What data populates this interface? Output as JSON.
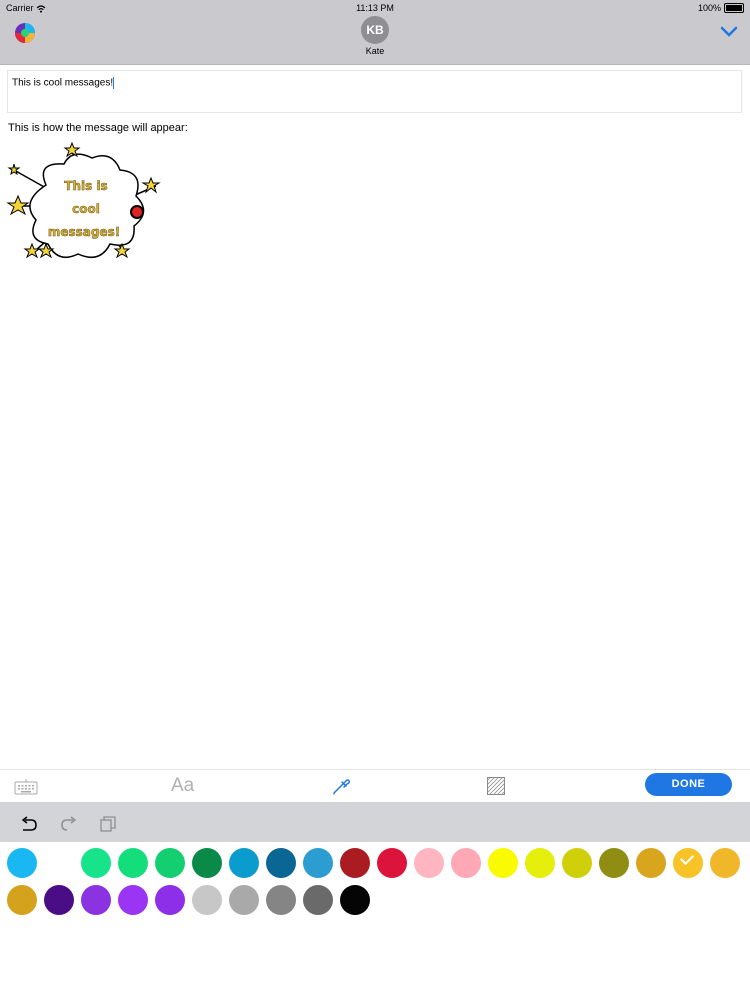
{
  "status_bar": {
    "carrier": "Carrier",
    "time": "11:13 PM",
    "battery": "100%"
  },
  "header": {
    "avatar_initials": "KB",
    "contact_name": "Kate"
  },
  "message": {
    "input_text": "This is cool messages!"
  },
  "preview": {
    "label": "This is how the message will appear:",
    "sticker_lines": [
      "This is",
      "cool",
      "messages!"
    ]
  },
  "toolbar": {
    "font_label": "Aa",
    "done_label": "DONE"
  },
  "icons": [
    "app-icon",
    "chevron-down-icon",
    "keyboard-icon",
    "font-icon",
    "eyedropper-icon",
    "pattern-icon",
    "undo-icon",
    "redo-icon",
    "copy-icon"
  ],
  "palette": {
    "selected_index": 18,
    "colors": [
      "#1ab8f2",
      "#ffffff",
      "#17e38a",
      "#14dd7c",
      "#13cf71",
      "#0a8a48",
      "#0a9ccc",
      "#0a6693",
      "#2b9dd0",
      "#aa1c21",
      "#dc143c",
      "#ffb6c1",
      "#fea9b5",
      "#fafa00",
      "#e6ee0c",
      "#cfcf0a",
      "#8f8d13",
      "#d9a41e",
      "#f7c326",
      "#f1b72a",
      "#d4a21c",
      "#4b0d86",
      "#8b32e1",
      "#9a35f4",
      "#8d2ee8",
      "#c7c7c7",
      "#a9a9a9",
      "#858585",
      "#6a6a6a",
      "#050505"
    ]
  }
}
